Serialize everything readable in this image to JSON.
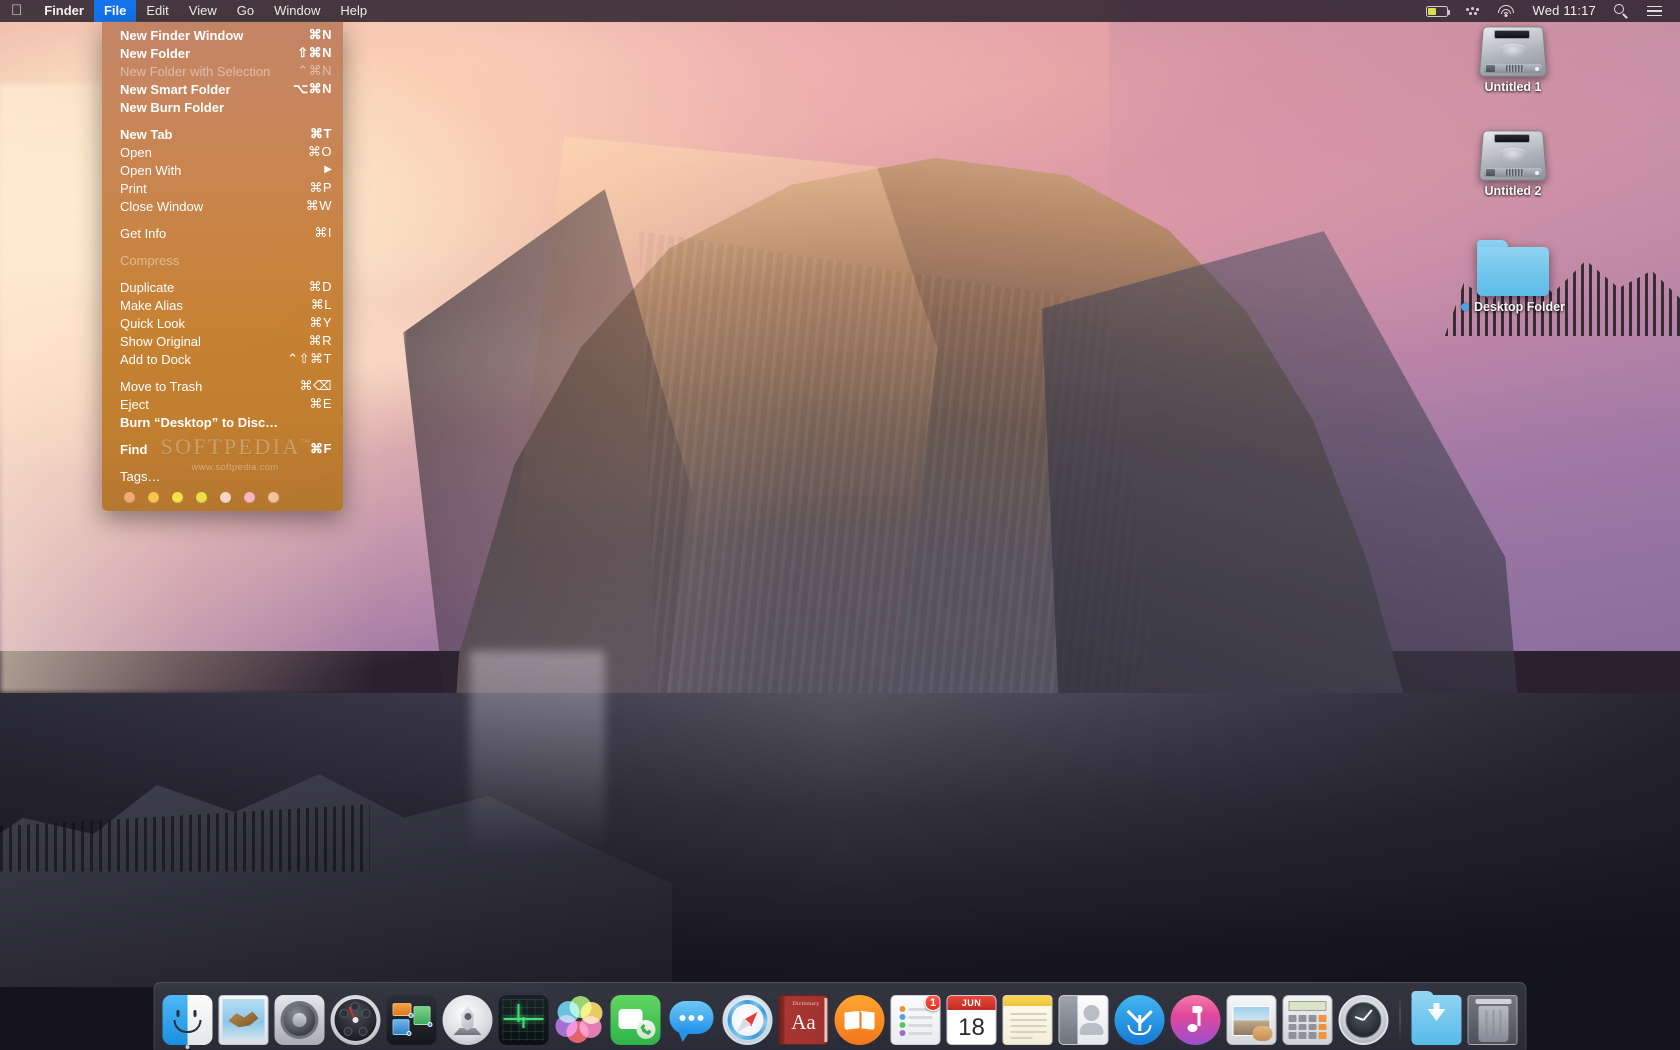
{
  "menubar": {
    "apple_glyph": "",
    "items": [
      {
        "label": "Finder",
        "bold": true,
        "active": false
      },
      {
        "label": "File",
        "bold": true,
        "active": true
      },
      {
        "label": "Edit",
        "bold": false,
        "active": false
      },
      {
        "label": "View",
        "bold": false,
        "active": false
      },
      {
        "label": "Go",
        "bold": false,
        "active": false
      },
      {
        "label": "Window",
        "bold": false,
        "active": false
      },
      {
        "label": "Help",
        "bold": false,
        "active": false
      }
    ],
    "status": {
      "battery_icon": "battery-icon",
      "bluetooth_icon": "dots-icon",
      "wifi_icon": "wifi-icon",
      "clock": "Wed 11:17",
      "search_icon": "search-icon",
      "notification_icon": "list-icon"
    }
  },
  "file_menu": {
    "title": "File",
    "groups": [
      {
        "rows": [
          {
            "label": "New Finder Window",
            "shortcut": "⌘N",
            "bold": true,
            "disabled": false
          },
          {
            "label": "New Folder",
            "shortcut": "⇧⌘N",
            "bold": true,
            "disabled": false
          },
          {
            "label": "New Folder with Selection",
            "shortcut": "⌃⌘N",
            "bold": false,
            "disabled": true
          },
          {
            "label": "New Smart Folder",
            "shortcut": "⌥⌘N",
            "bold": true,
            "disabled": false
          },
          {
            "label": "New Burn Folder",
            "shortcut": "",
            "bold": true,
            "disabled": false
          }
        ]
      },
      {
        "rows": [
          {
            "label": "New Tab",
            "shortcut": "⌘T",
            "bold": true,
            "disabled": false
          },
          {
            "label": "Open",
            "shortcut": "⌘O",
            "bold": false,
            "disabled": false
          },
          {
            "label": "Open With",
            "shortcut": "",
            "bold": false,
            "disabled": false,
            "submenu": true
          },
          {
            "label": "Print",
            "shortcut": "⌘P",
            "bold": false,
            "disabled": false
          },
          {
            "label": "Close Window",
            "shortcut": "⌘W",
            "bold": false,
            "disabled": false
          }
        ]
      },
      {
        "rows": [
          {
            "label": "Get Info",
            "shortcut": "⌘I",
            "bold": false,
            "disabled": false
          }
        ]
      },
      {
        "rows": [
          {
            "label": "Compress",
            "shortcut": "",
            "bold": false,
            "disabled": true
          }
        ]
      },
      {
        "rows": [
          {
            "label": "Duplicate",
            "shortcut": "⌘D",
            "bold": false,
            "disabled": false
          },
          {
            "label": "Make Alias",
            "shortcut": "⌘L",
            "bold": false,
            "disabled": false
          },
          {
            "label": "Quick Look",
            "shortcut": "⌘Y",
            "bold": false,
            "disabled": false
          },
          {
            "label": "Show Original",
            "shortcut": "⌘R",
            "bold": false,
            "disabled": false
          },
          {
            "label": "Add to Dock",
            "shortcut": "⌃⇧⌘T",
            "bold": false,
            "disabled": false
          }
        ]
      },
      {
        "rows": [
          {
            "label": "Move to Trash",
            "shortcut": "⌘⌫",
            "bold": false,
            "disabled": false
          },
          {
            "label": "Eject",
            "shortcut": "⌘E",
            "bold": false,
            "disabled": false
          },
          {
            "label": "Burn “Desktop” to Disc…",
            "shortcut": "",
            "bold": true,
            "disabled": false
          }
        ]
      },
      {
        "rows": [
          {
            "label": "Find",
            "shortcut": "⌘F",
            "bold": true,
            "disabled": false
          }
        ]
      },
      {
        "rows": [
          {
            "label": "Tags…",
            "shortcut": "",
            "bold": false,
            "disabled": false
          }
        ]
      }
    ],
    "tag_colors": [
      "#f2a878",
      "#f5c64a",
      "#f7e049",
      "#e9e04a",
      "#f6d6c8",
      "#f3b7bd",
      "#f0c39a"
    ],
    "watermark": {
      "brand": "SOFTPEDIA",
      "trademark": "™",
      "url": "www.softpedia.com"
    }
  },
  "desktop": {
    "icons": [
      {
        "name": "Untitled 1",
        "type": "harddrive",
        "tag": null
      },
      {
        "name": "Untitled 2",
        "type": "harddrive",
        "tag": null
      },
      {
        "name": "Desktop Folder",
        "type": "folder",
        "tag": "#4ea3e0"
      }
    ]
  },
  "dock": {
    "items": [
      {
        "name": "Finder",
        "icon": "finder-icon",
        "running": true,
        "badge": null
      },
      {
        "name": "Mail",
        "icon": "mail-icon",
        "running": false,
        "badge": null
      },
      {
        "name": "System Preferences",
        "icon": "system-preferences-icon",
        "running": false,
        "badge": null
      },
      {
        "name": "Dashboard",
        "icon": "dashboard-icon",
        "running": false,
        "badge": null
      },
      {
        "name": "Mission Control",
        "icon": "mission-control-icon",
        "running": false,
        "badge": null
      },
      {
        "name": "Launchpad",
        "icon": "launchpad-icon",
        "running": false,
        "badge": null
      },
      {
        "name": "Activity Monitor",
        "icon": "activity-monitor-icon",
        "running": false,
        "badge": null
      },
      {
        "name": "Photos",
        "icon": "photos-icon",
        "running": false,
        "badge": null
      },
      {
        "name": "FaceTime",
        "icon": "facetime-icon",
        "running": false,
        "badge": null
      },
      {
        "name": "Messages",
        "icon": "messages-icon",
        "running": false,
        "badge": null
      },
      {
        "name": "Safari",
        "icon": "safari-icon",
        "running": false,
        "badge": null
      },
      {
        "name": "Dictionary",
        "icon": "dictionary-icon",
        "running": false,
        "badge": null,
        "cover_title": "Dictionary",
        "cover_text": "Aa"
      },
      {
        "name": "iBooks",
        "icon": "ibooks-icon",
        "running": false,
        "badge": null
      },
      {
        "name": "Reminders",
        "icon": "reminders-icon",
        "running": false,
        "badge": "1"
      },
      {
        "name": "Calendar",
        "icon": "calendar-icon",
        "running": false,
        "badge": null,
        "month": "JUN",
        "day": "18"
      },
      {
        "name": "Notes",
        "icon": "notes-icon",
        "running": false,
        "badge": null
      },
      {
        "name": "Contacts",
        "icon": "contacts-icon",
        "running": false,
        "badge": null
      },
      {
        "name": "App Store",
        "icon": "app-store-icon",
        "running": false,
        "badge": null
      },
      {
        "name": "iTunes",
        "icon": "itunes-icon",
        "running": false,
        "badge": null
      },
      {
        "name": "iPhoto",
        "icon": "iphoto-icon",
        "running": false,
        "badge": null
      },
      {
        "name": "Calculator",
        "icon": "calculator-icon",
        "running": false,
        "badge": null
      },
      {
        "name": "Time Machine",
        "icon": "time-machine-icon",
        "running": false,
        "badge": null
      }
    ],
    "right_items": [
      {
        "name": "Downloads",
        "icon": "downloads-folder-icon"
      },
      {
        "name": "Trash",
        "icon": "trash-icon"
      }
    ]
  }
}
